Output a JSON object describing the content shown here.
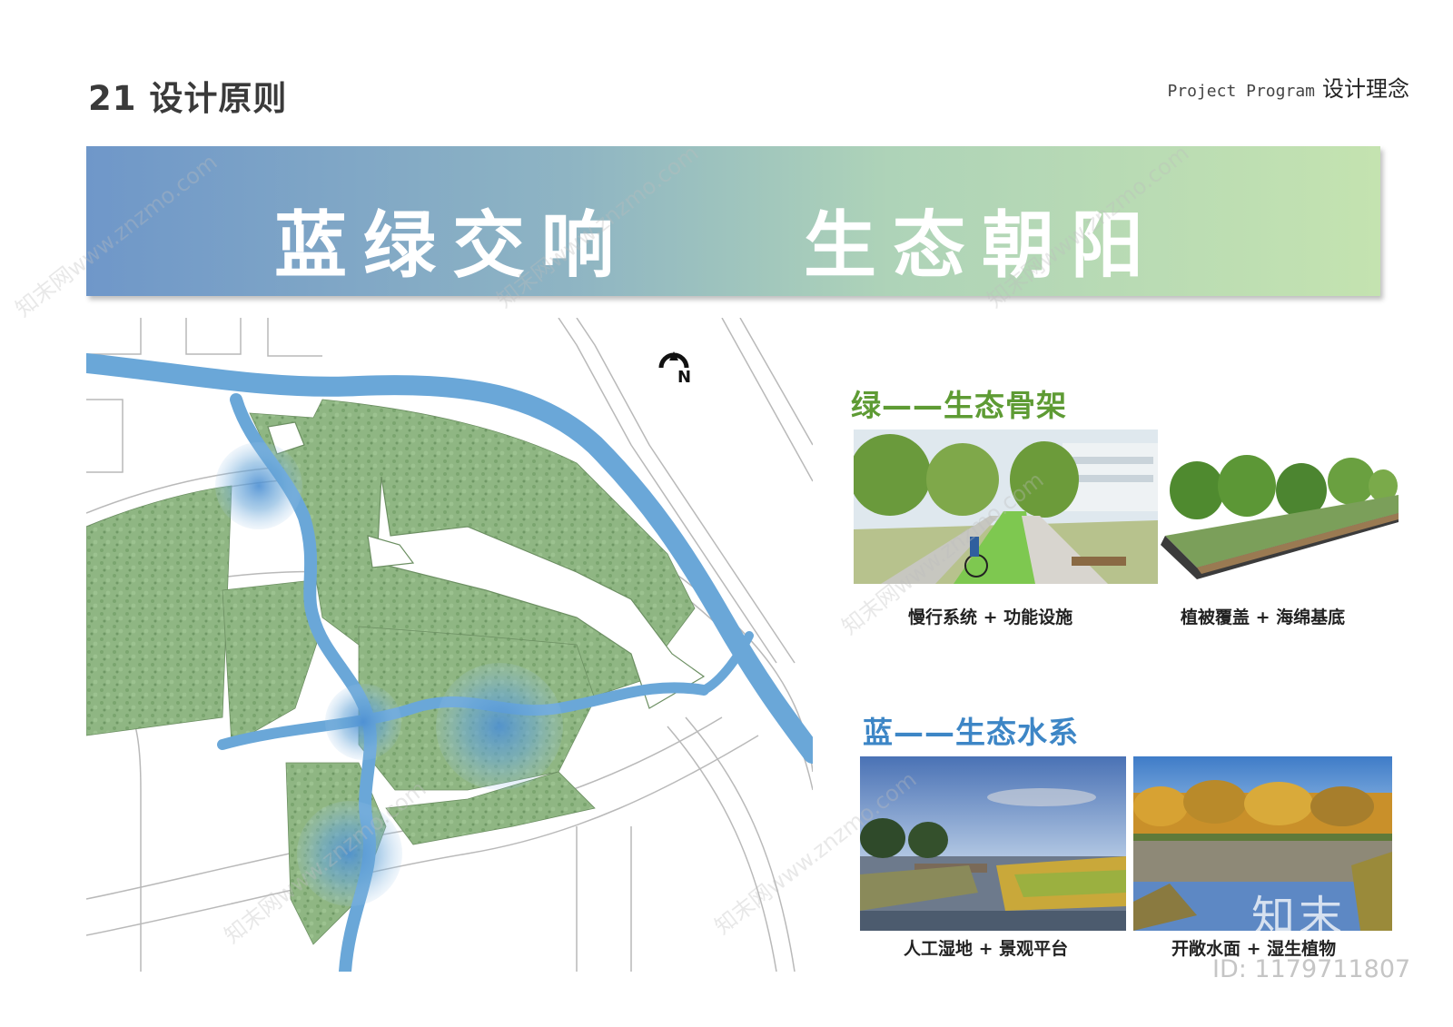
{
  "header": {
    "title": "21 设计原则",
    "subtitle_en": "Project Program",
    "subtitle_cn": "设计理念"
  },
  "banner": {
    "left_text": "蓝绿交响",
    "right_text": "生态朝阳"
  },
  "map": {
    "north_label": "N"
  },
  "green_section": {
    "heading": "绿——生态骨架",
    "photos": [
      {
        "caption": "慢行系统 + 功能设施"
      },
      {
        "caption": "植被覆盖 + 海绵基底"
      }
    ]
  },
  "blue_section": {
    "heading": "蓝——生态水系",
    "photos": [
      {
        "caption": "人工湿地 + 景观平台"
      },
      {
        "caption": "开敞水面 + 湿生植物"
      }
    ]
  },
  "watermark": {
    "logo_text": "知末",
    "id_text": "ID: 1179711807",
    "diagonal_text": "知末网www.znzmo.com"
  },
  "colors": {
    "green_heading": "#5e9b34",
    "blue_heading": "#3d86c6",
    "river": "#6aa7d8",
    "park_green": "#86b07a"
  }
}
